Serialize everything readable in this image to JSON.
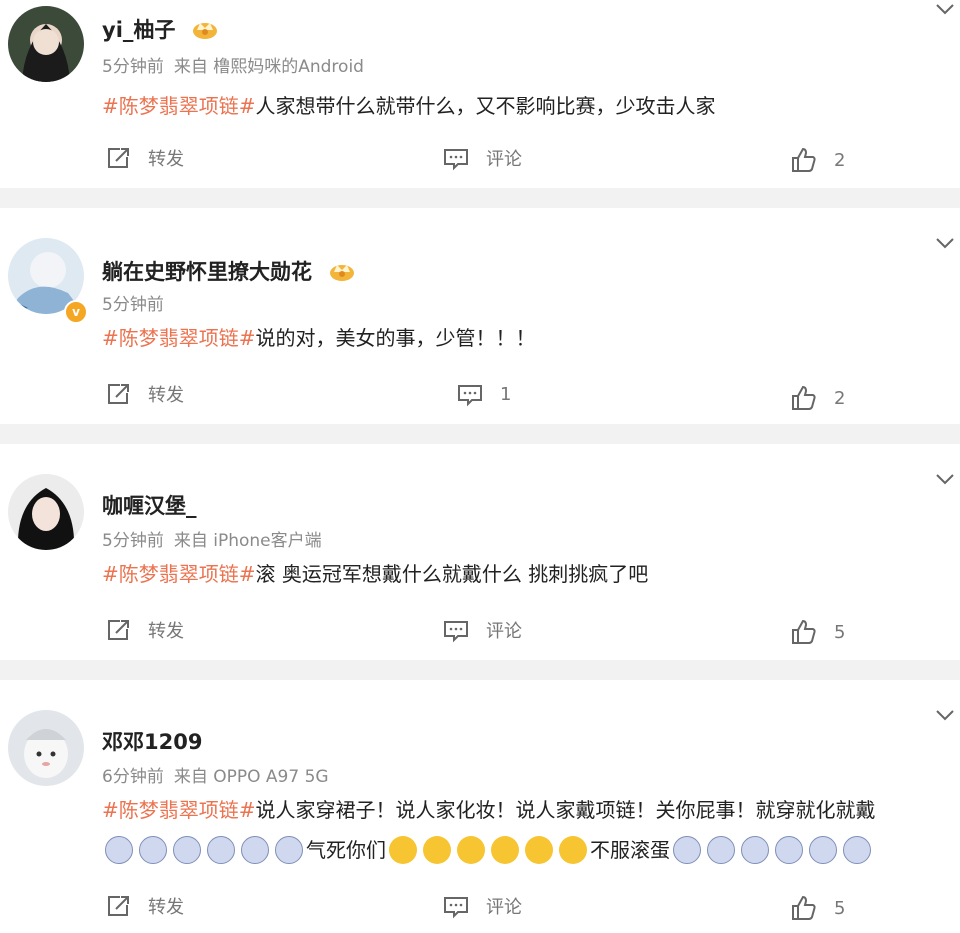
{
  "topic_tag": "#陈梦翡翠项链#",
  "posts": [
    {
      "username": "yi_柚子",
      "time": "5分钟前",
      "source": "来自 橹熙妈咪的Android",
      "body": "人家想带什么就带什么，又不影响比赛，少攻击人家",
      "repost_label": "转发",
      "comment_label": "评论",
      "like_count": "2"
    },
    {
      "username": "躺在史野怀里撩大勋花",
      "time": "5分钟前",
      "body": "说的对，美女的事，少管！！！",
      "repost_label": "转发",
      "comment_count": "1",
      "like_count": "2"
    },
    {
      "username": "咖喱汉堡_",
      "time": "5分钟前",
      "source": "来自 iPhone客户端",
      "body": "滚 奥运冠军想戴什么就戴什么 挑刺挑疯了吧",
      "repost_label": "转发",
      "comment_label": "评论",
      "like_count": "5"
    },
    {
      "username": "邓邓1209",
      "time": "6分钟前",
      "source": "来自 OPPO A97 5G",
      "body": "说人家穿裙子！说人家化妆！说人家戴项链！关你屁事！就穿就化就戴",
      "body_mid": "气死你们",
      "body_end": "不服滚蛋",
      "repost_label": "转发",
      "comment_label": "评论",
      "like_count": "5"
    }
  ],
  "colors": {
    "topic": "#eb7350",
    "background": "#f2f2f2",
    "verified": "#f5a623"
  },
  "icons": [
    "chevron-down-icon",
    "repost-icon",
    "comment-icon",
    "like-icon",
    "crown-icon",
    "verified-icon",
    "scared-emoji-icon",
    "laugh-emoji-icon"
  ]
}
